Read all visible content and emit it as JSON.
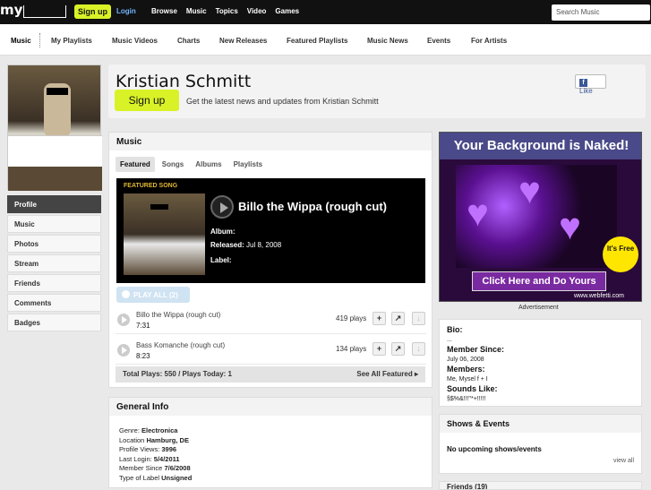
{
  "topbar": {
    "logo": "my",
    "signup": "Sign up",
    "login": "Login",
    "nav": [
      "Browse",
      "Music",
      "Topics",
      "Video",
      "Games"
    ],
    "search_placeholder": "Search Music"
  },
  "subnav": [
    "Music",
    "My Playlists",
    "Music Videos",
    "Charts",
    "New Releases",
    "Featured Playlists",
    "Music News",
    "Events",
    "For Artists"
  ],
  "sidebar": {
    "items": [
      "Profile",
      "Music",
      "Photos",
      "Stream",
      "Friends",
      "Comments",
      "Badges"
    ],
    "active": "Profile"
  },
  "header": {
    "name": "Kristian Schmitt",
    "signup": "Sign up",
    "tagline": "Get the latest news and updates from Kristian Schmitt",
    "like": "Like"
  },
  "music": {
    "title": "Music",
    "tabs": [
      "Featured",
      "Songs",
      "Albums",
      "Playlists"
    ],
    "featured_label": "FEATURED SONG",
    "featured_title": "Billo the Wippa (rough cut)",
    "album_label": "Album:",
    "released_label": "Released:",
    "released_value": "Jul 8, 2008",
    "label_label": "Label:",
    "play_all": "PLAY ALL (2)",
    "tracks": [
      {
        "name": "Billo the Wippa (rough cut)",
        "duration": "7:31",
        "plays": "419 plays"
      },
      {
        "name": "Bass Komanche (rough cut)",
        "duration": "8:23",
        "plays": "134 plays"
      }
    ],
    "totals": "Total Plays: 550 / Plays Today: 1",
    "see_all": "See All Featured ▸"
  },
  "general_info": {
    "title": "General Info",
    "lines": [
      {
        "label": "Genre: ",
        "value": "Electronica"
      },
      {
        "label": "Location ",
        "value": "Hamburg, DE"
      },
      {
        "label": "Profile Views: ",
        "value": "3996"
      },
      {
        "label": "Last Login: ",
        "value": "5/4/2011"
      },
      {
        "label": "Member Since ",
        "value": "7/6/2008"
      },
      {
        "label": "Type of Label ",
        "value": "Unsigned"
      }
    ]
  },
  "ad": {
    "headline": "Your Background is Naked!",
    "badge": "It's Free",
    "button": "Click Here and Do Yours",
    "url": "www.webfetti.com",
    "caption": "Advertisement"
  },
  "bio": {
    "bio_label": "Bio:",
    "bio_value": "...",
    "member_since_label": "Member Since:",
    "member_since_value": "July 06, 2008",
    "members_label": "Members:",
    "members_value": "Me, Mysel f + I",
    "sounds_like_label": "Sounds Like:",
    "sounds_like_value": "§$%&!!!\"*+!!!!!"
  },
  "shows": {
    "title": "Shows & Events",
    "empty": "No upcoming shows/events",
    "view_all": "view all"
  },
  "friends": {
    "title": "Friends (19)"
  }
}
